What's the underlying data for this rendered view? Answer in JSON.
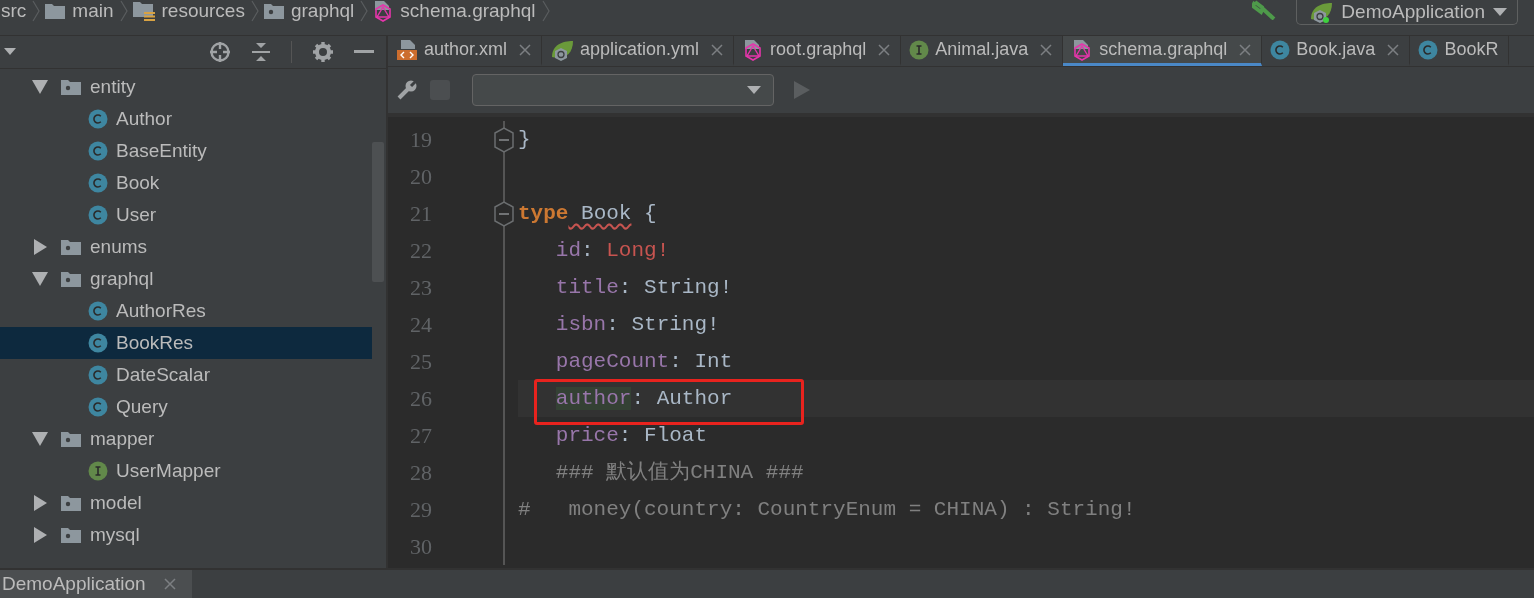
{
  "breadcrumbs": [
    {
      "label": "src",
      "kind": "none"
    },
    {
      "label": "main",
      "kind": "folder"
    },
    {
      "label": "resources",
      "kind": "resources"
    },
    {
      "label": "graphql",
      "kind": "package"
    },
    {
      "label": "schema.graphql",
      "kind": "graphql"
    }
  ],
  "run_config": {
    "label": "DemoApplication"
  },
  "project_tree": [
    {
      "label": "entity",
      "kind": "package",
      "expanded": true,
      "selected": false,
      "children": [
        {
          "label": "Author",
          "kind": "class",
          "selected": false
        },
        {
          "label": "BaseEntity",
          "kind": "class",
          "selected": false
        },
        {
          "label": "Book",
          "kind": "class",
          "selected": false
        },
        {
          "label": "User",
          "kind": "class",
          "selected": false
        }
      ]
    },
    {
      "label": "enums",
      "kind": "package",
      "expanded": false,
      "selected": false
    },
    {
      "label": "graphql",
      "kind": "package",
      "expanded": true,
      "selected": false,
      "children": [
        {
          "label": "AuthorRes",
          "kind": "class",
          "selected": false
        },
        {
          "label": "BookRes",
          "kind": "class",
          "selected": true
        },
        {
          "label": "DateScalar",
          "kind": "class",
          "selected": false
        },
        {
          "label": "Query",
          "kind": "class",
          "selected": false
        }
      ]
    },
    {
      "label": "mapper",
      "kind": "package",
      "expanded": true,
      "selected": false,
      "children": [
        {
          "label": "UserMapper",
          "kind": "interface",
          "selected": false
        }
      ]
    },
    {
      "label": "model",
      "kind": "package",
      "expanded": false,
      "selected": false
    },
    {
      "label": "mysql",
      "kind": "package",
      "expanded": false,
      "selected": false
    }
  ],
  "tabs": [
    {
      "label": "author.xml",
      "kind": "xml",
      "selected": false
    },
    {
      "label": "application.yml",
      "kind": "spring",
      "selected": false
    },
    {
      "label": "root.graphql",
      "kind": "graphql",
      "selected": false
    },
    {
      "label": "Animal.java",
      "kind": "interface",
      "selected": false
    },
    {
      "label": "schema.graphql",
      "kind": "graphql",
      "selected": true
    },
    {
      "label": "Book.java",
      "kind": "class",
      "selected": false
    },
    {
      "label": "BookR",
      "kind": "class",
      "selected": false
    }
  ],
  "code_lines": [
    {
      "number": "19",
      "fold": true,
      "current": false,
      "annotated": false,
      "tokens": [
        {
          "text": "}",
          "kind": "punct"
        }
      ]
    },
    {
      "number": "20",
      "fold": false,
      "current": false,
      "annotated": false
    },
    {
      "number": "21",
      "fold": true,
      "current": false,
      "annotated": false,
      "tokens": [
        {
          "text": "type",
          "kind": "keyword"
        },
        {
          "text": " Book",
          "kind": "warn"
        },
        {
          "text": " {",
          "kind": "punct"
        }
      ]
    },
    {
      "number": "22",
      "fold": false,
      "current": false,
      "annotated": false,
      "tokens": [
        {
          "text": "   id",
          "kind": "field"
        },
        {
          "text": ": ",
          "kind": "punct"
        },
        {
          "text": "Long!",
          "kind": "error"
        }
      ]
    },
    {
      "number": "23",
      "fold": false,
      "current": false,
      "annotated": false,
      "tokens": [
        {
          "text": "   title",
          "kind": "field"
        },
        {
          "text": ": ",
          "kind": "punct"
        },
        {
          "text": "String",
          "kind": "plain"
        },
        {
          "text": "!",
          "kind": "punct"
        }
      ]
    },
    {
      "number": "24",
      "fold": false,
      "current": false,
      "annotated": false,
      "tokens": [
        {
          "text": "   isbn",
          "kind": "field"
        },
        {
          "text": ": ",
          "kind": "punct"
        },
        {
          "text": "String",
          "kind": "plain"
        },
        {
          "text": "!",
          "kind": "punct"
        }
      ]
    },
    {
      "number": "25",
      "fold": false,
      "current": false,
      "annotated": false,
      "tokens": [
        {
          "text": "   pageCount",
          "kind": "field"
        },
        {
          "text": ": ",
          "kind": "punct"
        },
        {
          "text": "Int",
          "kind": "plain"
        }
      ]
    },
    {
      "number": "26",
      "fold": false,
      "current": true,
      "annotated": true,
      "tokens": [
        {
          "text": "   author",
          "kind": "usage"
        },
        {
          "text": ": ",
          "kind": "punct"
        },
        {
          "text": "Author",
          "kind": "plain"
        }
      ]
    },
    {
      "number": "27",
      "fold": false,
      "current": false,
      "annotated": false,
      "tokens": [
        {
          "text": "   price",
          "kind": "field"
        },
        {
          "text": ": ",
          "kind": "punct"
        },
        {
          "text": "Float",
          "kind": "plain"
        }
      ]
    },
    {
      "number": "28",
      "fold": false,
      "current": false,
      "annotated": false,
      "tokens": [
        {
          "text": "   ### 默认值为CHINA ###",
          "kind": "comment"
        }
      ]
    },
    {
      "number": "29",
      "fold": false,
      "current": false,
      "annotated": false,
      "tokens": [
        {
          "text": "#   money(country: CountryEnum = CHINA) : String!",
          "kind": "comment"
        }
      ]
    },
    {
      "number": "30",
      "fold": false,
      "current": false,
      "annotated": false
    }
  ],
  "editor_toolbar": {
    "validate_disabled": true,
    "run_disabled": true
  },
  "bottom_tabs": [
    {
      "label": "DemoApplication"
    }
  ]
}
